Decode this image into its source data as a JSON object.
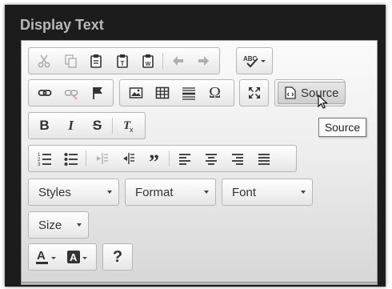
{
  "window": {
    "title": "Display Text"
  },
  "toolbar": {
    "source_label": "Source",
    "styles": "Styles",
    "format": "Format",
    "font": "Font",
    "size": "Size",
    "help": "?"
  },
  "tooltip": {
    "text": "Source"
  },
  "icons": [
    "cut-icon",
    "copy-icon",
    "paste-icon",
    "paste-text-icon",
    "paste-word-icon",
    "undo-icon",
    "redo-icon",
    "spellcheck-icon",
    "link-icon",
    "unlink-icon",
    "anchor-flag-icon",
    "image-icon",
    "table-icon",
    "horizontal-rule-icon",
    "special-char-icon",
    "maximize-icon",
    "source-icon",
    "bold-icon",
    "italic-icon",
    "strikethrough-icon",
    "remove-format-icon",
    "numbered-list-icon",
    "bulleted-list-icon",
    "outdent-icon",
    "indent-icon",
    "blockquote-icon",
    "align-left-icon",
    "align-center-icon",
    "align-right-icon",
    "justify-icon",
    "text-color-icon",
    "background-color-icon",
    "help-icon"
  ]
}
